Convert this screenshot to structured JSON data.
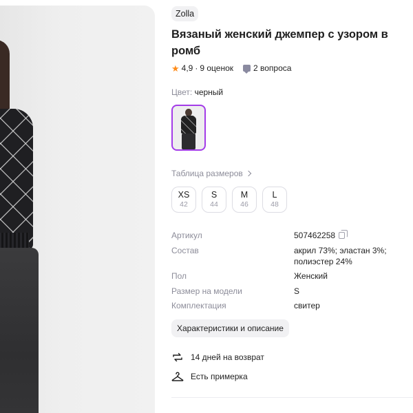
{
  "product": {
    "brand": "Zolla",
    "title": "Вязаный женский джемпер с узором в ромб",
    "rating": "4,9",
    "reviews": "9 оценок",
    "separator": "·",
    "questions": "2 вопроса",
    "color_label": "Цвет:",
    "color_value": "черный"
  },
  "sizes": {
    "table_link": "Таблица размеров",
    "items": [
      {
        "name": "XS",
        "ru": "42"
      },
      {
        "name": "S",
        "ru": "44"
      },
      {
        "name": "M",
        "ru": "46"
      },
      {
        "name": "L",
        "ru": "48"
      }
    ]
  },
  "specs": [
    {
      "key": "Артикул",
      "value": "507462258"
    },
    {
      "key": "Состав",
      "value": "акрил 73%; эластан 3%; полиэстер 24%"
    },
    {
      "key": "Пол",
      "value": "Женский"
    },
    {
      "key": "Размер на модели",
      "value": "S"
    },
    {
      "key": "Комплектация",
      "value": "свитер"
    }
  ],
  "description_button": "Характеристики и описание",
  "features": {
    "return": "14 дней на возврат",
    "fitting": "Есть примерка"
  },
  "colors": {
    "accent": "#a33be8",
    "star": "#ff8c1a",
    "muted_text": "#8c8c99"
  }
}
